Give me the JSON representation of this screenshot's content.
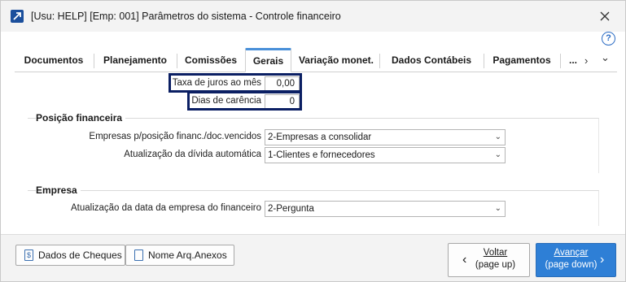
{
  "window": {
    "title": "[Usu: HELP] [Emp: 001] Parâmetros do sistema - Controle financeiro",
    "close_icon": "close-icon",
    "help_label": "?"
  },
  "tabs": [
    {
      "label": "Documentos"
    },
    {
      "label": "Planejamento"
    },
    {
      "label": "Comissões"
    },
    {
      "label": "Gerais",
      "active": true
    },
    {
      "label": "Variação monet."
    },
    {
      "label": "Dados Contábeis"
    },
    {
      "label": "Pagamentos"
    },
    {
      "label": "..."
    }
  ],
  "tab_nav": {
    "next": "›",
    "expand": "⌄"
  },
  "fields": {
    "taxa_juros": {
      "label": "Taxa de juros ao mês",
      "value": "0,00"
    },
    "dias_carencia": {
      "label": "Dias de carência",
      "value": "0"
    }
  },
  "posicao": {
    "title": "Posição financeira",
    "empresas_label": "Empresas p/posição financ./doc.vencidos",
    "empresas_value": "2-Empresas a consolidar",
    "atualizacao_label": "Atualização da dívida automática",
    "atualizacao_value": "1-Clientes e fornecedores"
  },
  "empresa": {
    "title": "Empresa",
    "data_label": "Atualização da data da empresa do financeiro",
    "data_value": "2-Pergunta"
  },
  "footer": {
    "cheques_label": "Dados de Cheques",
    "anexos_label": "Nome Arq.Anexos",
    "voltar_label": "Voltar",
    "voltar_hint": "(page up)",
    "avancar_label": "Avançar",
    "avancar_hint": "(page down)"
  },
  "colors": {
    "accent": "#2e7fd6",
    "highlight": "#0b1f63"
  }
}
